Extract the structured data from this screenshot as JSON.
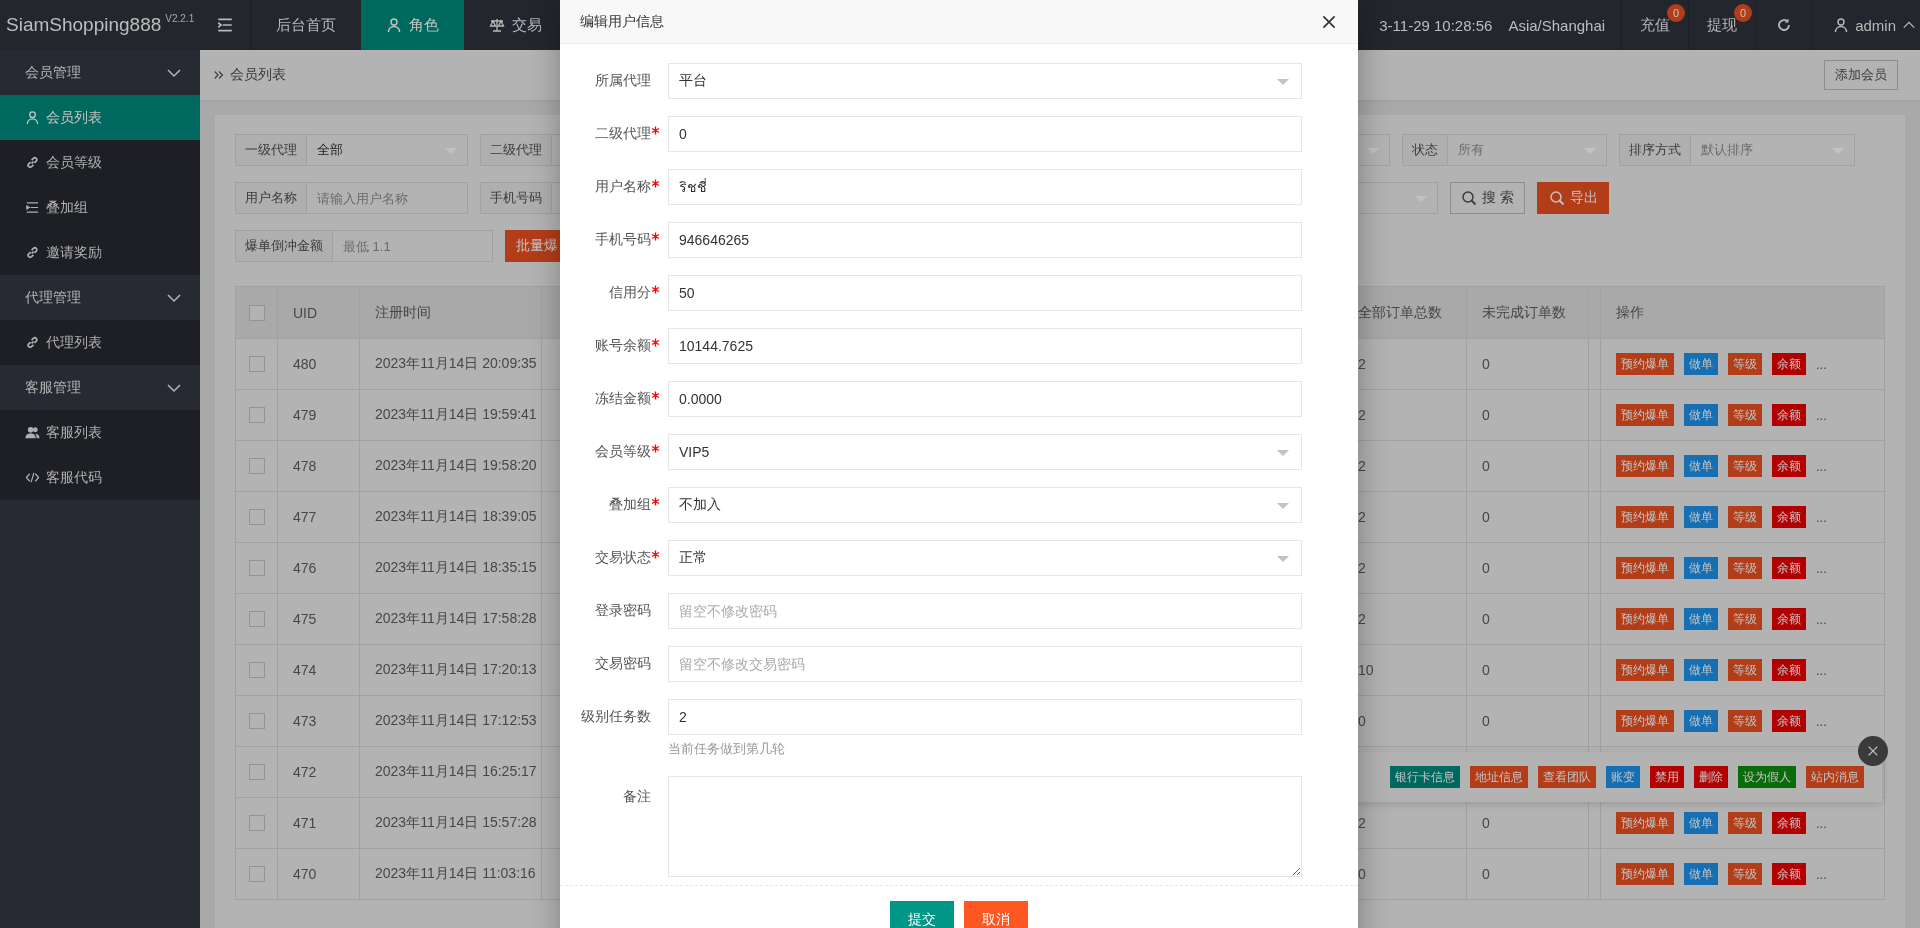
{
  "brand": {
    "name": "SiamShopping888",
    "version": "V2.2.1"
  },
  "topnav": {
    "items": [
      {
        "label": "后台首页",
        "selected": false
      },
      {
        "label": "角色",
        "selected": true
      },
      {
        "label": "交易",
        "selected": false
      }
    ],
    "time": "3-11-29 10:28:56",
    "timezone": "Asia/Shanghai",
    "counters": [
      {
        "label": "充值",
        "badge": "0"
      },
      {
        "label": "提现",
        "badge": "0"
      }
    ],
    "user": "admin"
  },
  "sidebar": {
    "groups": [
      {
        "label": "会员管理",
        "expanded": true,
        "children": [
          {
            "label": "会员列表",
            "selected": true
          },
          {
            "label": "会员等级",
            "selected": false
          },
          {
            "label": "叠加组",
            "selected": false
          },
          {
            "label": "邀请奖励",
            "selected": false
          }
        ]
      },
      {
        "label": "代理管理",
        "expanded": true,
        "children": [
          {
            "label": "代理列表",
            "selected": false
          }
        ]
      },
      {
        "label": "客服管理",
        "expanded": true,
        "children": [
          {
            "label": "客服列表",
            "selected": false
          },
          {
            "label": "客服代码",
            "selected": false
          }
        ]
      }
    ]
  },
  "breadcrumb": {
    "current": "会员列表",
    "action": "添加会员"
  },
  "filters": [
    [
      {
        "kind": "select",
        "label": "一级代理",
        "value": "全部"
      },
      {
        "kind": "select",
        "label": "二级代理"
      },
      {
        "kind": "select"
      },
      {
        "kind": "select",
        "label": "状态",
        "placeholder": "所有"
      },
      {
        "kind": "select",
        "label": "排序方式",
        "placeholder": "默认排序"
      }
    ],
    [
      {
        "kind": "input",
        "label": "用户名称",
        "placeholder": "请输入用户名称"
      },
      {
        "kind": "input",
        "label": "手机号码"
      },
      {
        "kind": "select"
      },
      {
        "kind": "search",
        "label": "搜 索"
      },
      {
        "kind": "export",
        "label": "导出"
      }
    ],
    [
      {
        "kind": "input",
        "label": "爆单倒冲金额",
        "placeholder": "最低 1.1"
      },
      {
        "kind": "batch",
        "label": "批量爆"
      }
    ]
  ],
  "table": {
    "all_checked": false,
    "columns": [
      "UID",
      "注册时间",
      "全部订单总数",
      "未完成订单数",
      "操作"
    ],
    "rows": [
      {
        "uid": "480",
        "registered": "2023年11月14日 20:09:35",
        "total_orders": "2",
        "open_orders": "0",
        "checked": false,
        "menu_open": false,
        "more": "...",
        "actions": [
          {
            "label": "预约爆单",
            "color": "#b23d18"
          },
          {
            "label": "做单",
            "color": "#156fb2"
          },
          {
            "label": "等级",
            "color": "#b23d18"
          },
          {
            "label": "余额",
            "color": "#b20000"
          }
        ]
      },
      {
        "uid": "479",
        "registered": "2023年11月14日 19:59:41",
        "total_orders": "2",
        "open_orders": "0",
        "checked": false,
        "menu_open": false,
        "more": "...",
        "actions": [
          {
            "label": "预约爆单",
            "color": "#b23d18"
          },
          {
            "label": "做单",
            "color": "#156fb2"
          },
          {
            "label": "等级",
            "color": "#b23d18"
          },
          {
            "label": "余额",
            "color": "#b20000"
          }
        ]
      },
      {
        "uid": "478",
        "registered": "2023年11月14日 19:58:20",
        "total_orders": "2",
        "open_orders": "0",
        "checked": false,
        "menu_open": false,
        "more": "...",
        "actions": [
          {
            "label": "预约爆单",
            "color": "#b23d18"
          },
          {
            "label": "做单",
            "color": "#156fb2"
          },
          {
            "label": "等级",
            "color": "#b23d18"
          },
          {
            "label": "余额",
            "color": "#b20000"
          }
        ]
      },
      {
        "uid": "477",
        "registered": "2023年11月14日 18:39:05",
        "total_orders": "2",
        "open_orders": "0",
        "checked": false,
        "menu_open": false,
        "more": "...",
        "actions": [
          {
            "label": "预约爆单",
            "color": "#b23d18"
          },
          {
            "label": "做单",
            "color": "#156fb2"
          },
          {
            "label": "等级",
            "color": "#b23d18"
          },
          {
            "label": "余额",
            "color": "#b20000"
          }
        ]
      },
      {
        "uid": "476",
        "registered": "2023年11月14日 18:35:15",
        "total_orders": "2",
        "open_orders": "0",
        "checked": false,
        "menu_open": false,
        "more": "...",
        "actions": [
          {
            "label": "预约爆单",
            "color": "#b23d18"
          },
          {
            "label": "做单",
            "color": "#156fb2"
          },
          {
            "label": "等级",
            "color": "#b23d18"
          },
          {
            "label": "余额",
            "color": "#b20000"
          }
        ]
      },
      {
        "uid": "475",
        "registered": "2023年11月14日 17:58:28",
        "total_orders": "2",
        "open_orders": "0",
        "checked": false,
        "menu_open": false,
        "more": "...",
        "actions": [
          {
            "label": "预约爆单",
            "color": "#b23d18"
          },
          {
            "label": "做单",
            "color": "#156fb2"
          },
          {
            "label": "等级",
            "color": "#b23d18"
          },
          {
            "label": "余额",
            "color": "#b20000"
          }
        ]
      },
      {
        "uid": "474",
        "registered": "2023年11月14日 17:20:13",
        "total_orders": "10",
        "open_orders": "0",
        "checked": false,
        "menu_open": false,
        "more": "...",
        "actions": [
          {
            "label": "预约爆单",
            "color": "#b23d18"
          },
          {
            "label": "做单",
            "color": "#156fb2"
          },
          {
            "label": "等级",
            "color": "#b23d18"
          },
          {
            "label": "余额",
            "color": "#b20000"
          }
        ]
      },
      {
        "uid": "473",
        "registered": "2023年11月14日 17:12:53",
        "total_orders": "0",
        "open_orders": "0",
        "checked": false,
        "menu_open": false,
        "more": "...",
        "actions": [
          {
            "label": "预约爆单",
            "color": "#b23d18"
          },
          {
            "label": "做单",
            "color": "#156fb2"
          },
          {
            "label": "等级",
            "color": "#b23d18"
          },
          {
            "label": "余额",
            "color": "#b20000"
          }
        ]
      },
      {
        "uid": "472",
        "registered": "2023年11月14日 16:25:17",
        "checked": false,
        "menu_open": true
      },
      {
        "uid": "471",
        "registered": "2023年11月14日 15:57:28",
        "total_orders": "2",
        "open_orders": "0",
        "checked": false,
        "menu_open": false,
        "more": "...",
        "actions": [
          {
            "label": "预约爆单",
            "color": "#b23d18"
          },
          {
            "label": "做单",
            "color": "#156fb2"
          },
          {
            "label": "等级",
            "color": "#b23d18"
          },
          {
            "label": "余额",
            "color": "#b20000"
          }
        ]
      },
      {
        "uid": "470",
        "registered": "2023年11月14日 11:03:16",
        "total_orders": "0",
        "open_orders": "0",
        "checked": false,
        "menu_open": false,
        "more": "...",
        "actions": [
          {
            "label": "预约爆单",
            "color": "#b23d18"
          },
          {
            "label": "做单",
            "color": "#156fb2"
          },
          {
            "label": "等级",
            "color": "#b23d18"
          },
          {
            "label": "余额",
            "color": "#b20000"
          }
        ]
      }
    ],
    "row_menu": [
      {
        "label": "银行卡信息",
        "color": "#00695f"
      },
      {
        "label": "地址信息",
        "color": "#b23d18"
      },
      {
        "label": "查看团队",
        "color": "#b23d18"
      },
      {
        "label": "账变",
        "color": "#156fb2"
      },
      {
        "label": "禁用",
        "color": "#b20000"
      },
      {
        "label": "删除",
        "color": "#b20000"
      },
      {
        "label": "设为假人",
        "color": "#0a6b0a"
      },
      {
        "label": "站内消息",
        "color": "#b23d18"
      }
    ]
  },
  "modal": {
    "title": "编辑用户信息",
    "fields": [
      {
        "label": "所属代理",
        "required": false,
        "kind": "select",
        "value": "平台"
      },
      {
        "label": "二级代理",
        "required": true,
        "kind": "input",
        "value": "0"
      },
      {
        "label": "用户名称",
        "required": true,
        "kind": "input",
        "value": "ริชชี่"
      },
      {
        "label": "手机号码",
        "required": true,
        "kind": "input",
        "value": "946646265"
      },
      {
        "label": "信用分",
        "required": true,
        "kind": "input",
        "value": "50"
      },
      {
        "label": "账号余额",
        "required": true,
        "kind": "input",
        "value": "10144.7625"
      },
      {
        "label": "冻结金额",
        "required": true,
        "kind": "input",
        "value": "0.0000"
      },
      {
        "label": "会员等级",
        "required": true,
        "kind": "select",
        "value": "VIP5"
      },
      {
        "label": "叠加组",
        "required": true,
        "kind": "select",
        "value": "不加入"
      },
      {
        "label": "交易状态",
        "required": true,
        "kind": "select",
        "value": "正常"
      },
      {
        "label": "登录密码",
        "required": false,
        "kind": "input",
        "placeholder": "留空不修改密码"
      },
      {
        "label": "交易密码",
        "required": false,
        "kind": "input",
        "placeholder": "留空不修改交易密码"
      },
      {
        "label": "级别任务数",
        "required": false,
        "kind": "input",
        "value": "2",
        "hint": "当前任务做到第几轮"
      },
      {
        "label": "备注",
        "required": false,
        "kind": "textarea"
      }
    ],
    "buttons": [
      {
        "kind": "submit",
        "label": "提交"
      },
      {
        "kind": "cancel",
        "label": "取消"
      }
    ]
  }
}
